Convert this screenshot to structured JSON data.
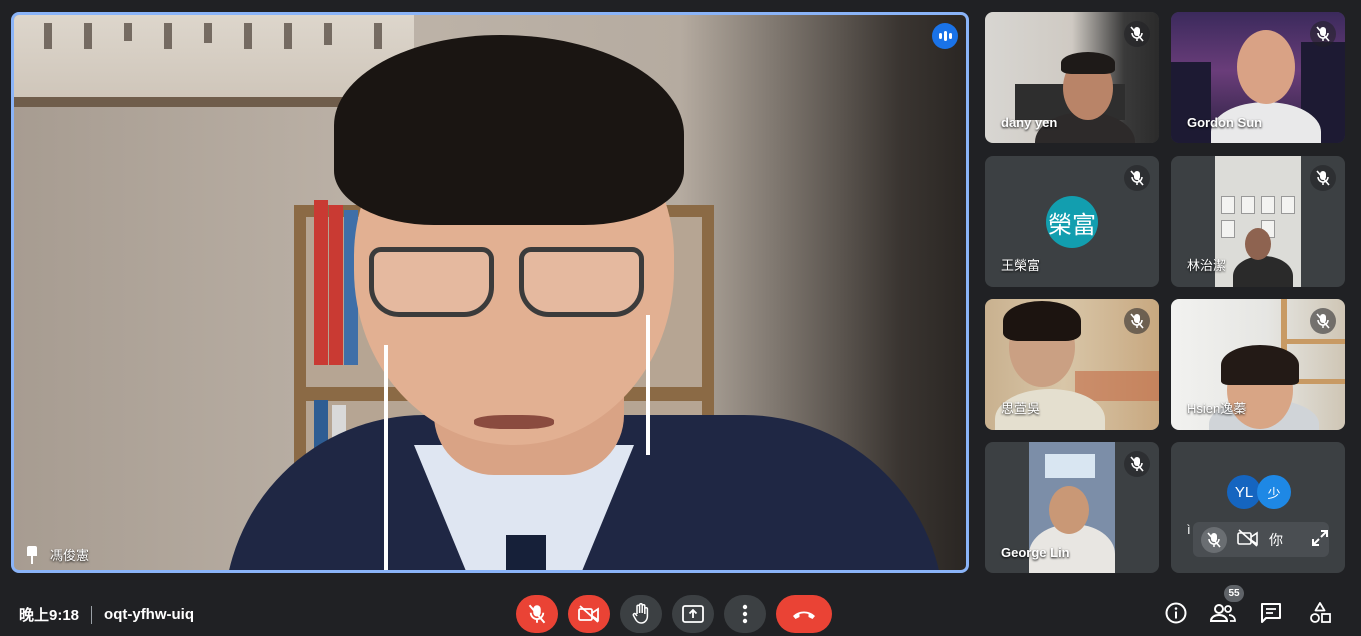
{
  "main_speaker": {
    "name": "馮俊憲"
  },
  "participants": [
    {
      "name": "dany yen"
    },
    {
      "name": "Gordon Sun"
    },
    {
      "name": "王榮富",
      "avatar_text": "榮富",
      "avatar_color": "#129eaf"
    },
    {
      "name": "林治潔"
    },
    {
      "name": "思萱吳"
    },
    {
      "name": "Hsien逸蓁"
    },
    {
      "name": "George Lin"
    }
  ],
  "others_tile": {
    "avatars": [
      {
        "text": "YL",
        "color": "#1565c0"
      },
      {
        "text": "少",
        "color": "#1e88e5"
      }
    ],
    "left_text": "ì",
    "hover_label": "你"
  },
  "meeting": {
    "time": "晚上9:18",
    "code": "oqt-yfhw-uiq"
  },
  "controls": {
    "mic": {
      "icon": "mic-off-icon",
      "color": "#ea4335"
    },
    "camera": {
      "icon": "camera-off-icon",
      "color": "#ea4335"
    },
    "raise_hand": {
      "icon": "hand-icon"
    },
    "present": {
      "icon": "present-icon"
    },
    "more": {
      "icon": "more-vert-icon"
    },
    "leave": {
      "icon": "hang-up-icon",
      "color": "#ea4335"
    }
  },
  "side_panel": {
    "participant_count": "55",
    "icons": [
      "info-icon",
      "people-icon",
      "chat-icon",
      "activities-icon"
    ]
  },
  "accent": "#8ab4f8"
}
